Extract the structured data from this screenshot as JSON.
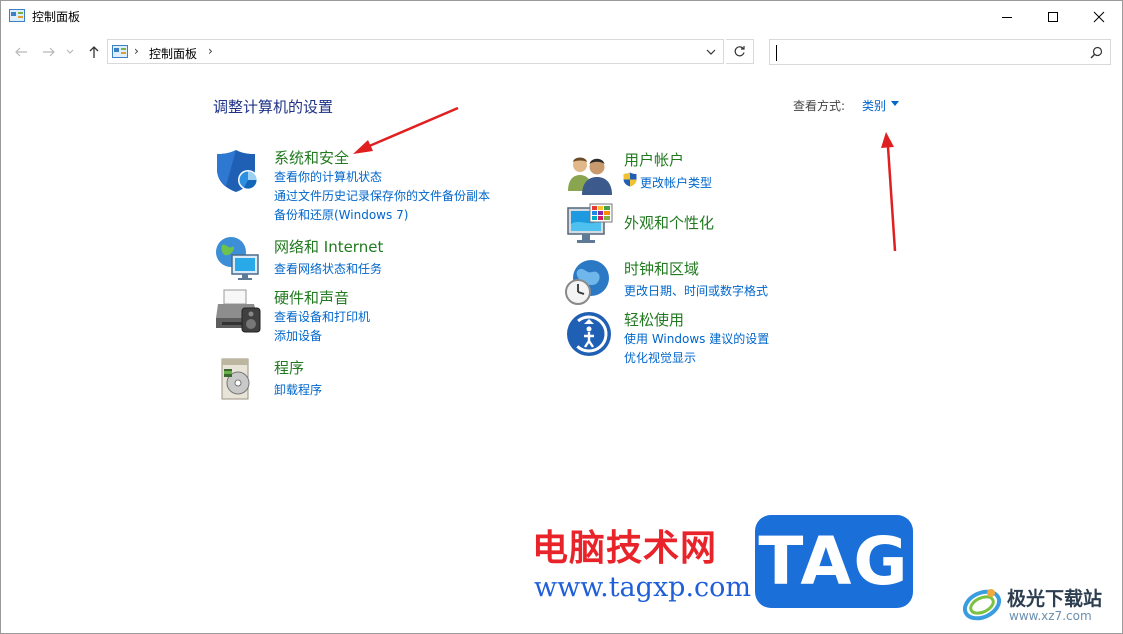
{
  "window": {
    "title": "控制面板"
  },
  "address": {
    "path": "控制面板",
    "separator": "›"
  },
  "search": {
    "placeholder": ""
  },
  "header": {
    "heading": "调整计算机的设置",
    "view_by_label": "查看方式:",
    "view_by_value": "类别"
  },
  "categories": [
    {
      "title": "系统和安全",
      "icon": "shield-icon",
      "links": [
        "查看你的计算机状态",
        "通过文件历史记录保存你的文件备份副本",
        "备份和还原(Windows 7)"
      ]
    },
    {
      "title": "网络和 Internet",
      "icon": "network-globe-icon",
      "links": [
        "查看网络状态和任务"
      ]
    },
    {
      "title": "硬件和声音",
      "icon": "printer-icon",
      "links": [
        "查看设备和打印机",
        "添加设备"
      ]
    },
    {
      "title": "程序",
      "icon": "programs-icon",
      "links": [
        "卸载程序"
      ]
    },
    {
      "title": "用户帐户",
      "icon": "users-icon",
      "links": [
        "更改帐户类型"
      ]
    },
    {
      "title": "外观和个性化",
      "icon": "appearance-monitor-icon",
      "links": []
    },
    {
      "title": "时钟和区域",
      "icon": "clock-globe-icon",
      "links": [
        "更改日期、时间或数字格式"
      ]
    },
    {
      "title": "轻松使用",
      "icon": "ease-of-access-icon",
      "links": [
        "使用 Windows 建议的设置",
        "优化视觉显示"
      ]
    }
  ],
  "watermark": {
    "cn": "电脑技术网",
    "url": "www.tagxp.com",
    "tag": "TAG",
    "site_cn": "极光下载站",
    "site_url": "www.xz7.com"
  },
  "colors": {
    "heading": "#1e3287",
    "category": "#217a1f",
    "link": "#0066cc",
    "arrow": "#e02020"
  }
}
